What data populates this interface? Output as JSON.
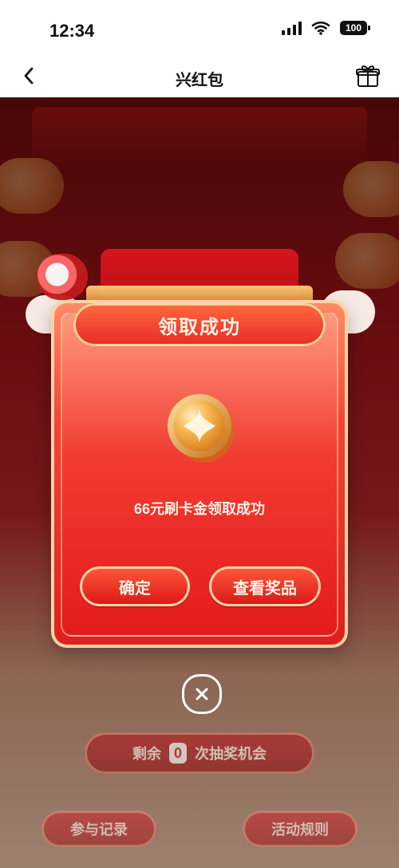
{
  "status_bar": {
    "time": "12:34",
    "battery": "100",
    "icons": [
      "signal-icon",
      "wifi-icon",
      "battery-icon"
    ]
  },
  "nav": {
    "title": "兴红包",
    "back_icon": "chevron-left-icon",
    "gift_icon": "gift-icon"
  },
  "modal": {
    "title": "领取成功",
    "reward_text": "66元刷卡金领取成功",
    "confirm_label": "确定",
    "view_prize_label": "查看奖品",
    "close_icon": "close-icon",
    "coin_icon": "coin-icon"
  },
  "background": {
    "remaining_prefix": "剩余",
    "remaining_count": "0",
    "remaining_suffix": "次抽奖机会",
    "records_label": "参与记录",
    "rules_label": "活动规则"
  },
  "colors": {
    "accent_red": "#e41c1c",
    "accent_gold": "#f6c45c"
  }
}
